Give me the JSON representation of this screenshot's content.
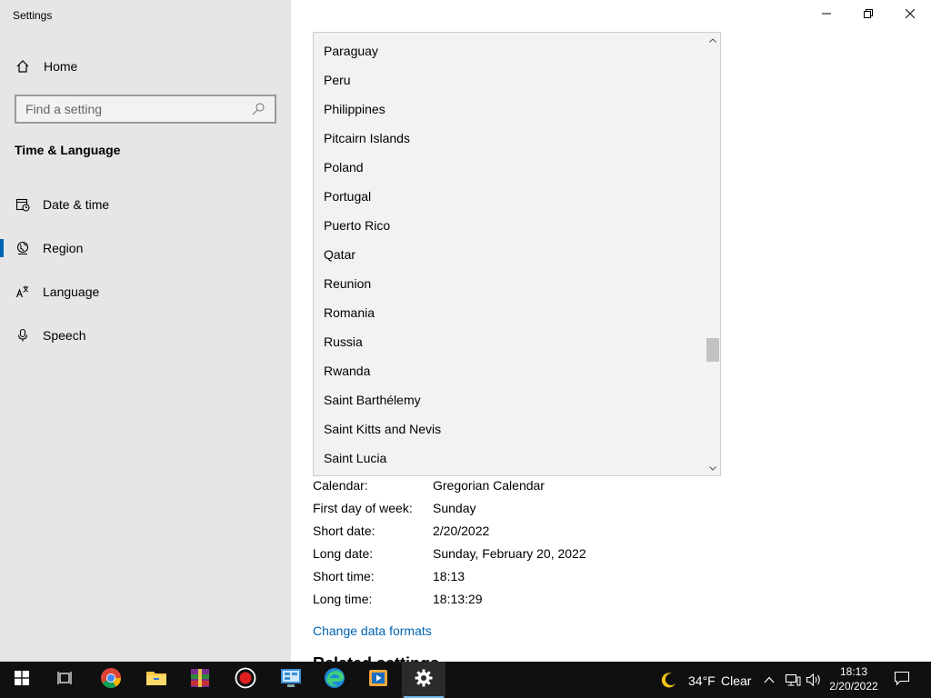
{
  "window": {
    "title": "Settings"
  },
  "sidebar": {
    "home_label": "Home",
    "search_placeholder": "Find a setting",
    "section_title": "Time & Language",
    "items": [
      {
        "label": "Date & time",
        "icon": "calendar-clock-icon"
      },
      {
        "label": "Region",
        "icon": "globe-icon",
        "active": true
      },
      {
        "label": "Language",
        "icon": "language-icon"
      },
      {
        "label": "Speech",
        "icon": "microphone-icon"
      }
    ]
  },
  "dropdown": {
    "items": [
      "Paraguay",
      "Peru",
      "Philippines",
      "Pitcairn Islands",
      "Poland",
      "Portugal",
      "Puerto Rico",
      "Qatar",
      "Reunion",
      "Romania",
      "Russia",
      "Rwanda",
      "Saint Barthélemy",
      "Saint Kitts and Nevis",
      "Saint Lucia"
    ]
  },
  "formats": {
    "rows": [
      {
        "label": "Calendar:",
        "value": "Gregorian Calendar"
      },
      {
        "label": "First day of week:",
        "value": "Sunday"
      },
      {
        "label": "Short date:",
        "value": "2/20/2022"
      },
      {
        "label": "Long date:",
        "value": "Sunday, February 20, 2022"
      },
      {
        "label": "Short time:",
        "value": "18:13"
      },
      {
        "label": "Long time:",
        "value": "18:13:29"
      }
    ],
    "change_link": "Change data formats",
    "related_heading": "Related settings"
  },
  "taskbar": {
    "weather_temp": "34°F",
    "weather_desc": "Clear",
    "time": "18:13",
    "date": "2/20/2022"
  },
  "colors": {
    "accent": "#0063b1",
    "sidebar_bg": "#e6e6e6",
    "taskbar_bg": "#101010"
  }
}
